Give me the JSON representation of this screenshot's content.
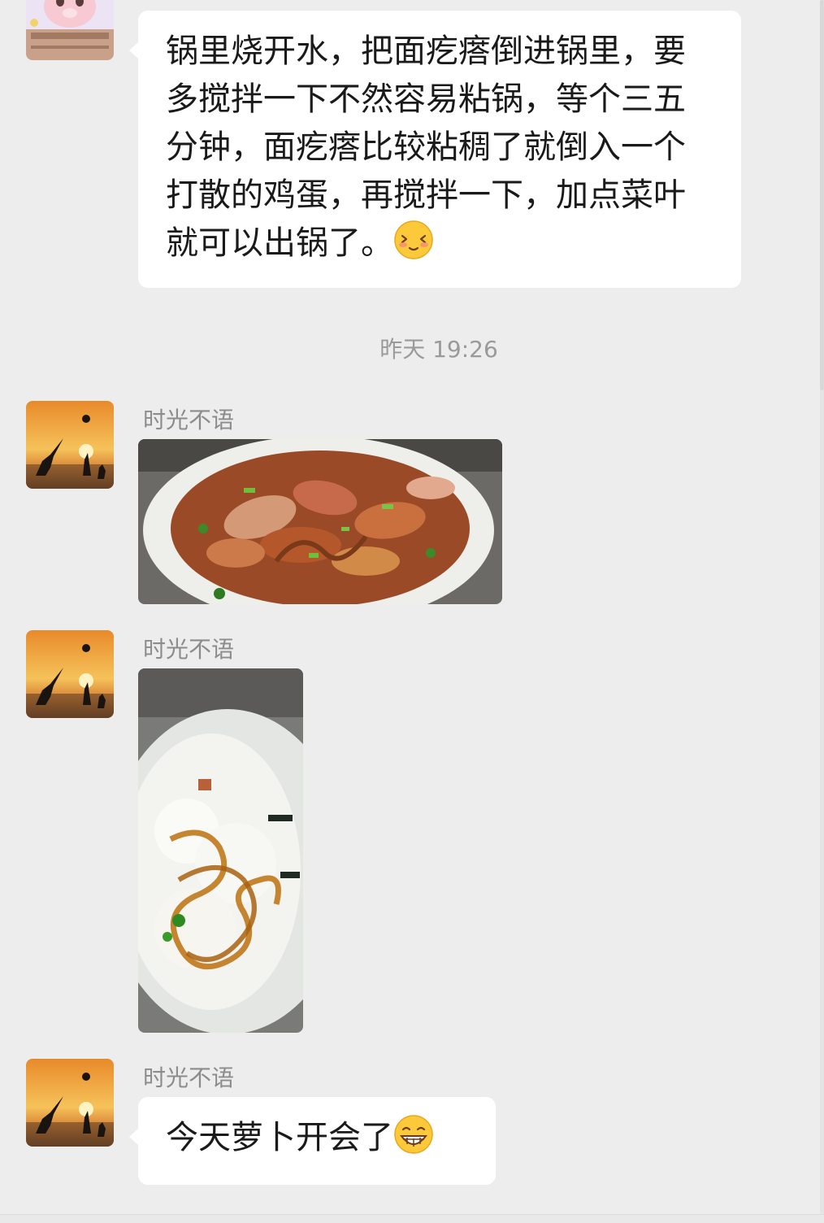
{
  "messages": [
    {
      "text": "锅里烧开水，把面疙瘩倒进锅里，要多搅拌一下不然容易粘锅，等个三五分钟，面疙瘩比较粘稠了就倒入一个打散的鸡蛋，再搅拌一下，加点菜叶就可以出锅了。",
      "emoji": "shy-blush-emoji"
    },
    {
      "sender": "时光不语",
      "image": "stir-fried-radish-dish-photo"
    },
    {
      "sender": "时光不语",
      "image": "rice-with-noodles-photo"
    },
    {
      "sender": "时光不语",
      "text": "今天萝卜开会了",
      "emoji": "grinning-emoji"
    }
  ],
  "timestamp": "昨天 19:26",
  "colors": {
    "background": "#ededed",
    "bubble": "#ffffff",
    "name": "#8c8c8c",
    "timestamp": "#9a9a9a"
  }
}
